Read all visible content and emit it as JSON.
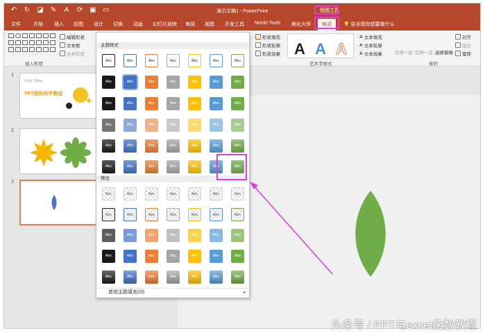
{
  "window": {
    "doc_title": "演示文稿1 - PowerPoint",
    "context_title": "绘图工具"
  },
  "tabs": [
    "文件",
    "开始",
    "插入",
    "绘图",
    "设计",
    "切换",
    "动画",
    "幻灯片放映",
    "审阅",
    "视图",
    "开发工具",
    "Nordri Tools",
    "美化大师",
    "格式"
  ],
  "active_tab": "格式",
  "tell_me": "告诉我你想要做什么",
  "ribbon": {
    "insert_shapes": {
      "edit_shape": "编辑形状",
      "text_box": "文本框",
      "merge_shapes": "合并形状",
      "label": "插入形状"
    },
    "shape_styles": {
      "fill": "形状填充",
      "outline": "形状轮廓",
      "effects": "形状效果"
    },
    "wordart": {
      "text_fill": "文本填充",
      "text_outline": "文本轮廓",
      "text_effects": "文本效果",
      "label": "艺术字样式",
      "sample_glyph": "A",
      "sample_colors": [
        "#222222",
        "#4a90d9",
        "#e8834a"
      ]
    },
    "arrange": {
      "bring_forward": "前移一层",
      "send_backward": "后移一层",
      "selection_pane": "选择窗格",
      "align": "对齐",
      "group": "组合",
      "rotate": "旋转",
      "label": "排列"
    }
  },
  "slides": [
    {
      "number": "1",
      "title": "PPT图形的字数组",
      "caption": "Sorry Today"
    },
    {
      "number": "2"
    },
    {
      "number": "3"
    }
  ],
  "gallery": {
    "section_theme": "主题样式",
    "section_presets": "预设",
    "cell_label": "Abc",
    "more_fills": "其他主题填充(O)",
    "theme_colors": [
      "#1a1a1a",
      "#4472c4",
      "#ed7d31",
      "#a5a5a5",
      "#ffc000",
      "#5b9bd5",
      "#70ad47"
    ]
  },
  "watermark": "头条号 / PPT与excel函数教程",
  "colors": {
    "accent": "#b7472a",
    "highlight": "#e13be0",
    "leaf": "#70ad47"
  }
}
